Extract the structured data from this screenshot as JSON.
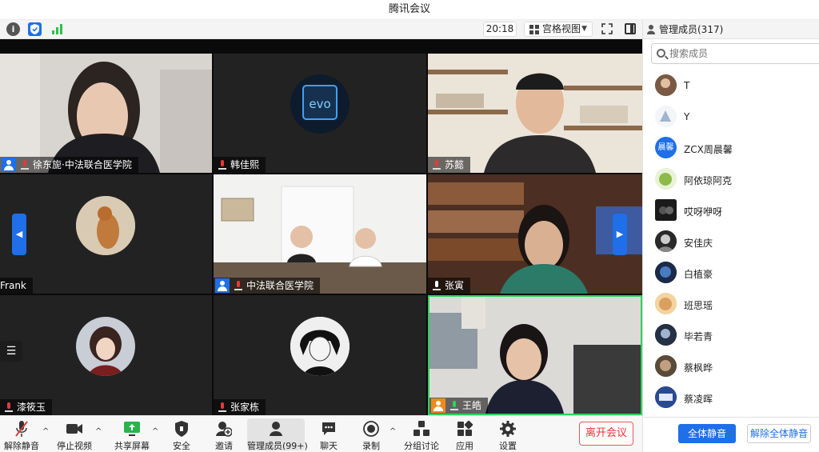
{
  "window": {
    "title": "腾讯会议"
  },
  "toolbar": {
    "time": "20:18",
    "view_mode": "宫格视图"
  },
  "tiles": [
    {
      "name": "徐东旎·中法联合医学院"
    },
    {
      "name": "韩佳熙"
    },
    {
      "name": "苏懿"
    },
    {
      "name": "Frank"
    },
    {
      "name": "中法联合医学院"
    },
    {
      "name": "张寅"
    },
    {
      "name": "漆筱玉"
    },
    {
      "name": "张家栋"
    },
    {
      "name": "王皓"
    }
  ],
  "bottom_bar": {
    "unmute": "解除静音",
    "stop_video": "停止视频",
    "share_screen": "共享屏幕",
    "security": "安全",
    "invite": "邀请",
    "manage_members": "管理成员(99+)",
    "chat": "聊天",
    "record": "录制",
    "breakout": "分组讨论",
    "apps": "应用",
    "settings": "设置",
    "leave": "离开会议"
  },
  "panel": {
    "title": "管理成员(317)",
    "search_placeholder": "搜索成员",
    "members": [
      {
        "name": "T"
      },
      {
        "name": "Y"
      },
      {
        "name": "ZCX周晨馨",
        "avatar_text": "晨馨"
      },
      {
        "name": "阿依琼阿克"
      },
      {
        "name": "哎呀咿呀"
      },
      {
        "name": "安佳庆"
      },
      {
        "name": "白植豪"
      },
      {
        "name": "班思瑶"
      },
      {
        "name": "毕若青"
      },
      {
        "name": "蔡枫晔"
      },
      {
        "name": "蔡凌晖"
      }
    ],
    "mute_all": "全体静音",
    "unmute_all": "解除全体静音"
  },
  "colors": {
    "accent": "#1e6fe8",
    "leave": "#e33333",
    "mic_muted": "#e23b3b",
    "mic_active": "#2fd15c"
  }
}
